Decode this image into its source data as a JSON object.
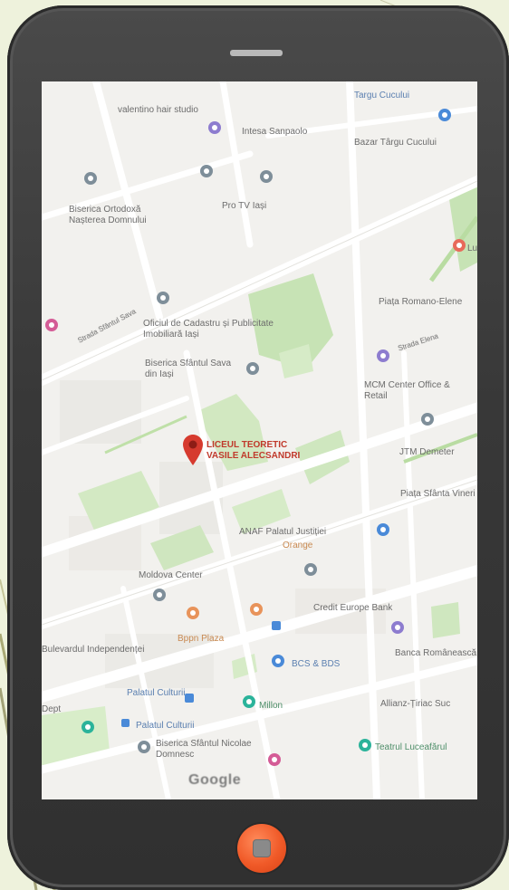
{
  "map": {
    "labels": {
      "valentino": "valentino hair studio",
      "targu_cucului": "Targu Cucului",
      "intesa": "Intesa Sanpaolo",
      "bazar": "Bazar Târgu Cucului",
      "biserica_ortodoxa": "Biserica Ortodoxă Nașterea Domnului",
      "pro_tv": "Pro TV Iași",
      "oficiul": "Oficiul de Cadastru și Publicitate Imobiliară Iași",
      "biserica_sava": "Biserica Sfântul Sava din Iași",
      "piata_romano": "Piața Romano-Elene",
      "mcm_center": "MCM Center Office & Retail",
      "destination": "LICEUL TEORETIC VASILE ALECSANDRI",
      "jtm": "JTM Demeter",
      "piata_vineri": "Piața Sfânta Vineri",
      "anaf": "ANAF Palatul Justiției",
      "orange": "Orange",
      "moldova_center": "Moldova Center",
      "credit_europe": "Credit Europe Bank",
      "bppn": "Bppn Plaza",
      "banca_romaneasca": "Banca Românească",
      "bcs": "BCS & BDS",
      "palatul_culturii": "Palatul Culturii",
      "palatul_culturii2": "Palatul Culturii",
      "millon": "Millon",
      "biserica_nicolae": "Biserica Sfântul Nicolae Domnesc",
      "teatrul": "Teatrul Luceafărul",
      "allianz": "Allianz-Țiriac Suc",
      "bdul_independentei": "Bulevardul Independenței",
      "strada_sf_sava": "Strada Sfântul Sava",
      "strada_elena": "Strada Elena",
      "dept": "Dept",
      "luci": "Luci"
    },
    "attribution": "Google",
    "colors": {
      "land": "#f2f1ee",
      "road": "#ffffff",
      "park": "#c7e3b5",
      "pin": "#d63a2e",
      "poi_gray": "#7e8e99",
      "poi_blue": "#4a8ad8",
      "poi_teal": "#2bb39a",
      "poi_purple": "#8d7ccf",
      "poi_pink": "#d45c96",
      "poi_orange": "#e8935a"
    }
  },
  "device": {
    "body_color": "#3c3c3c",
    "home_button_color": "#f05a28"
  }
}
